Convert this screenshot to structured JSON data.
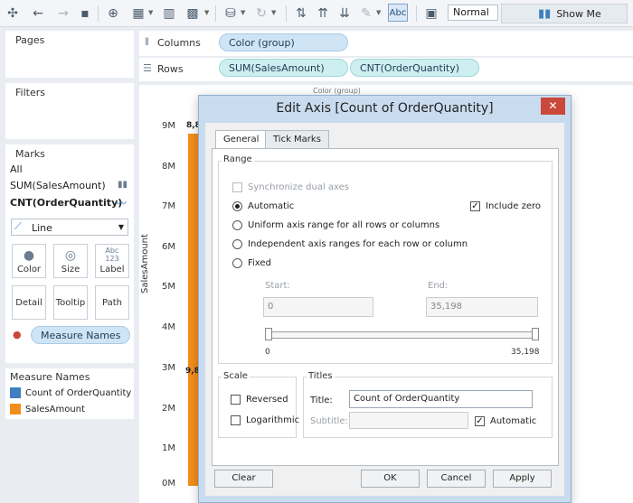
{
  "toolbar": {
    "format_dropdown_value": "Normal",
    "abc_label": "Abc",
    "show_me_label": "Show Me"
  },
  "left": {
    "pages_title": "Pages",
    "filters_title": "Filters",
    "marks_title": "Marks",
    "marks_all": "All",
    "marks_sum": "SUM(SalesAmount)",
    "marks_cnt": "CNT(OrderQuantity)",
    "mark_type": "Line",
    "buttons": {
      "color": "Color",
      "size": "Size",
      "label": "Label",
      "detail": "Detail",
      "tooltip": "Tooltip",
      "path": "Path"
    },
    "measure_names_pill": "Measure Names",
    "legend_title": "Measure Names",
    "legend_items": [
      {
        "label": "Count of OrderQuantity",
        "color": "#3f7fc1"
      },
      {
        "label": "SalesAmount",
        "color": "#f28e1c"
      }
    ]
  },
  "shelves": {
    "columns_label": "Columns",
    "columns_pill": "Color (group)",
    "rows_label": "Rows",
    "rows_pill_1": "SUM(SalesAmount)",
    "rows_pill_2": "CNT(OrderQuantity)"
  },
  "view": {
    "header_partial": "Color (group)",
    "y_axis_title": "SalesAmount",
    "y_ticks": [
      "9M",
      "8M",
      "7M",
      "6M",
      "5M",
      "4M",
      "3M",
      "2M",
      "1M",
      "0M"
    ],
    "bar_label_top": "8,8",
    "bar_label_mid": "9,8"
  },
  "dialog": {
    "title": "Edit Axis [Count of OrderQuantity]",
    "close": "✕",
    "tabs": [
      "General",
      "Tick Marks"
    ],
    "range_title": "Range",
    "sync_dual": "Synchronize dual axes",
    "automatic": "Automatic",
    "include_zero": "Include zero",
    "uniform": "Uniform axis range for all rows or columns",
    "independent": "Independent axis ranges for each row or column",
    "fixed": "Fixed",
    "start_label": "Start:",
    "end_label": "End:",
    "start_value": "0",
    "end_value": "35,198",
    "slider_min": "0",
    "slider_max": "35,198",
    "scale_title": "Scale",
    "reversed": "Reversed",
    "logarithmic": "Logarithmic",
    "titles_title": "Titles",
    "title_label": "Title:",
    "title_value": "Count of OrderQuantity",
    "subtitle_label": "Subtitle:",
    "subtitle_automatic": "Automatic",
    "clear": "Clear",
    "ok": "OK",
    "cancel": "Cancel",
    "apply": "Apply"
  }
}
